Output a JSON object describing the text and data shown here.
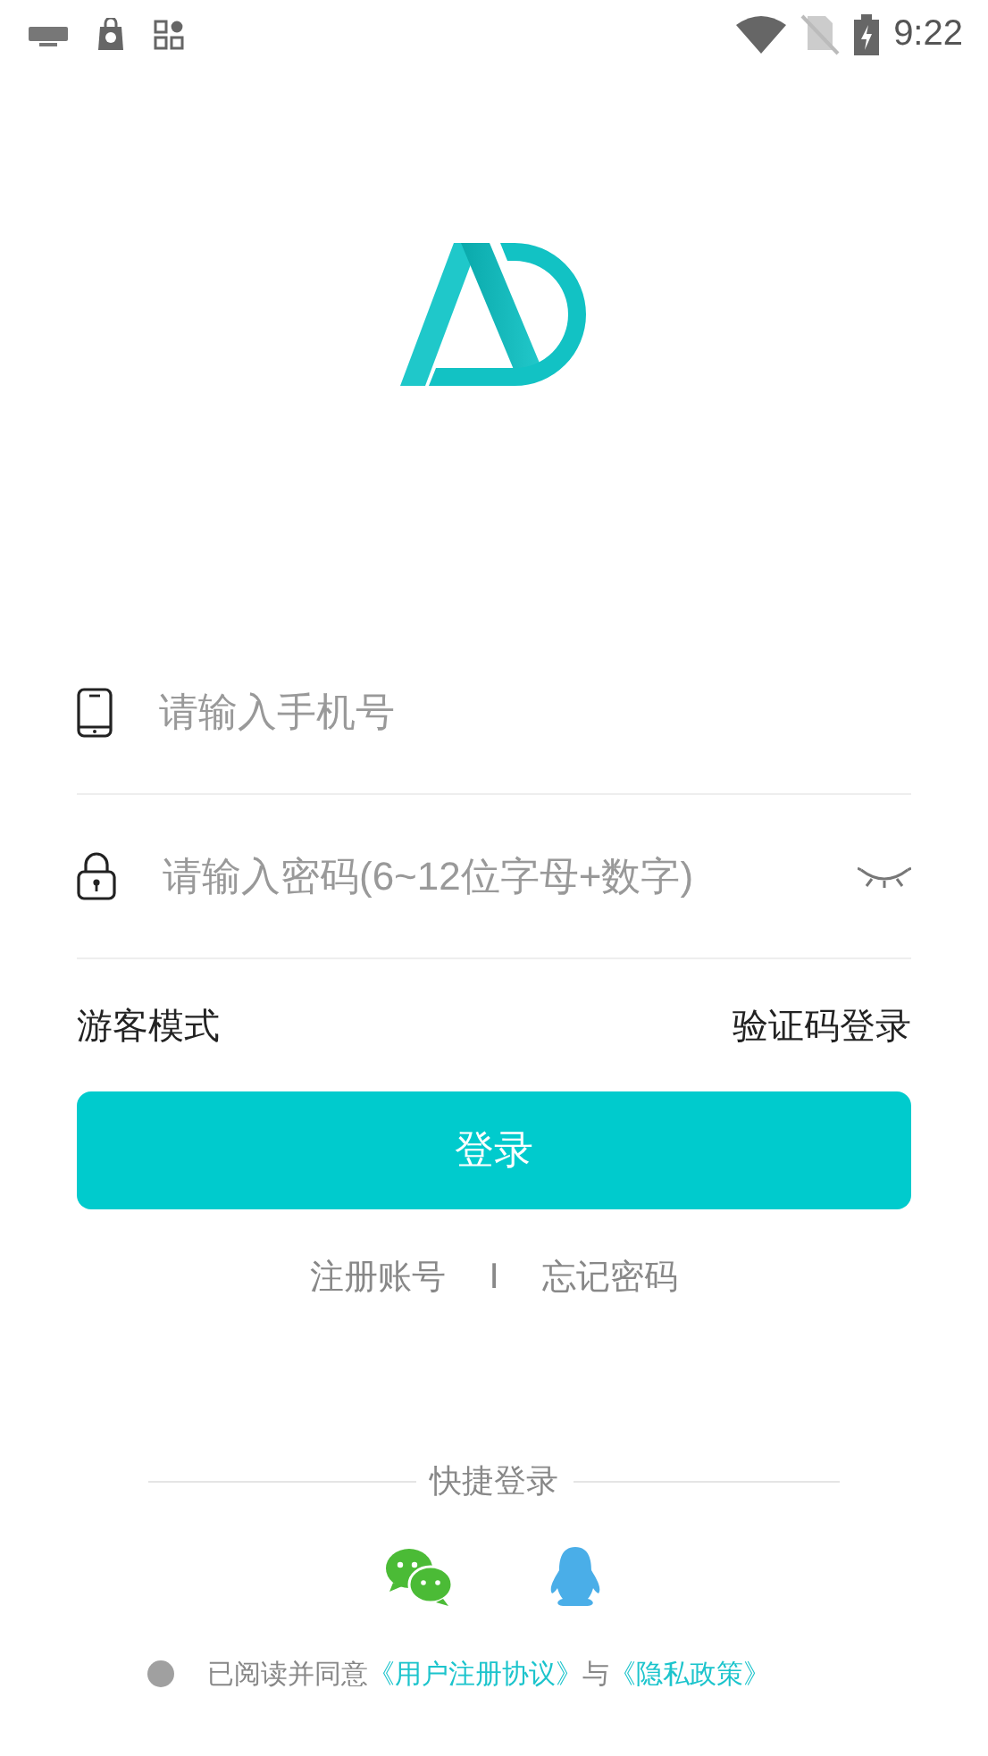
{
  "status_bar": {
    "time": "9:22"
  },
  "form": {
    "phone": {
      "placeholder": "请输入手机号"
    },
    "password": {
      "placeholder": "请输入密码(6~12位字母+数字)",
      "visible": false
    }
  },
  "links": [
    "游客模式",
    "验证码登录"
  ],
  "login_button": "登录",
  "secondary_links": [
    "注册账号",
    "I",
    "忘记密码"
  ],
  "quick_login": {
    "title": "快捷登录",
    "providers": [
      {
        "kind": "wechat"
      },
      {
        "kind": "qq"
      }
    ]
  },
  "agreement": {
    "agreed": false,
    "text": "已阅读并同意",
    "terms": "《用户注册协议》",
    "and": "与",
    "privacy": "《隐私政策》"
  }
}
